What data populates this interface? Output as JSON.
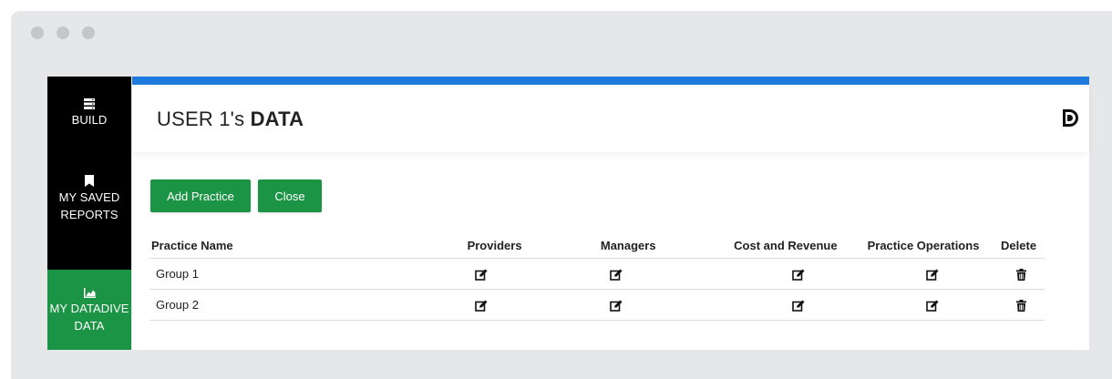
{
  "sidebar": {
    "items": [
      {
        "label_line1": "BUILD",
        "label_line2": "",
        "icon": "server-stack-icon",
        "active": false
      },
      {
        "label_line1": "MY SAVED",
        "label_line2": "REPORTS",
        "icon": "bookmark-icon",
        "active": false
      },
      {
        "label_line1": "MY DATADIVE",
        "label_line2": "DATA",
        "icon": "area-chart-icon",
        "active": true
      }
    ]
  },
  "header": {
    "title_prefix": "USER 1's ",
    "title_bold": "DATA",
    "logo_icon": "datadive-logo-icon"
  },
  "toolbar": {
    "add_label": "Add Practice",
    "close_label": "Close"
  },
  "table": {
    "headers": [
      "Practice Name",
      "Providers",
      "Managers",
      "Cost and Revenue",
      "Practice Operations",
      "Delete"
    ],
    "rows": [
      {
        "name": "Group 1"
      },
      {
        "name": "Group 2"
      }
    ],
    "edit_icon": "edit-icon",
    "delete_icon": "trash-icon"
  },
  "colors": {
    "accent_blue": "#1f7ae0",
    "brand_green": "#1b9446",
    "sidebar_bg": "#000000"
  }
}
